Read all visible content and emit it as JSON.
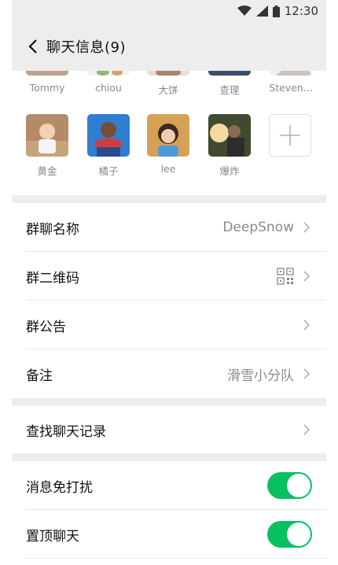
{
  "status_bar": {
    "time": "12:30"
  },
  "nav": {
    "title": "聊天信息(9)"
  },
  "members_top": [
    {
      "name": "Tommy"
    },
    {
      "name": "chiou"
    },
    {
      "name": "大饼"
    },
    {
      "name": "查理"
    },
    {
      "name": "Steven..."
    }
  ],
  "members_bottom": [
    {
      "name": "黄金"
    },
    {
      "name": "橘子"
    },
    {
      "name": "lee"
    },
    {
      "name": "爆炸"
    }
  ],
  "settings": {
    "group_name": {
      "label": "群聊名称",
      "value": "DeepSnow"
    },
    "qr_code": {
      "label": "群二维码"
    },
    "announcement": {
      "label": "群公告"
    },
    "remark": {
      "label": "备注",
      "value": "滑雪小分队"
    },
    "search_history": {
      "label": "查找聊天记录"
    },
    "mute": {
      "label": "消息免打扰",
      "enabled": true
    },
    "pin": {
      "label": "置顶聊天",
      "enabled": true
    }
  },
  "colors": {
    "accent": "#07c160",
    "background": "#ededed"
  }
}
